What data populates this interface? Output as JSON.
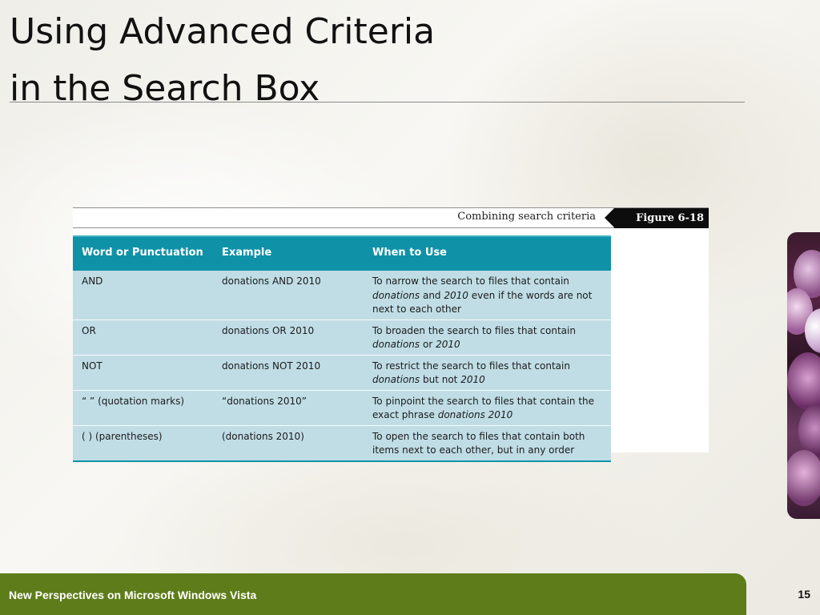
{
  "slide": {
    "title_line1": "Using Advanced Criteria",
    "title_line2": "in the Search Box"
  },
  "figure": {
    "caption": "Combining search criteria",
    "tag": "Figure 6-18",
    "table": {
      "headers": [
        "Word or Punctuation",
        "Example",
        "When to Use"
      ],
      "rows": [
        {
          "word": "AND",
          "example": "donations AND 2010",
          "use_parts": [
            "To narrow the search to files that contain ",
            "donations",
            " and ",
            "2010",
            " even if the words are not next to each other"
          ]
        },
        {
          "word": "OR",
          "example": "donations OR 2010",
          "use_parts": [
            "To broaden the search to files that contain ",
            "donations",
            " or ",
            "2010",
            ""
          ]
        },
        {
          "word": "NOT",
          "example": "donations NOT 2010",
          "use_parts": [
            "To restrict the search to files that contain ",
            "donations",
            " but not ",
            "2010",
            ""
          ]
        },
        {
          "word": "“ ” (quotation marks)",
          "example": "“donations 2010”",
          "use_parts": [
            "To pinpoint the search to files that contain the exact phrase ",
            "donations 2010",
            "",
            "",
            ""
          ]
        },
        {
          "word": "( ) (parentheses)",
          "example": "(donations 2010)",
          "use_parts": [
            "To open the search to files that contain both items next to each other, but in any order",
            "",
            "",
            "",
            ""
          ]
        }
      ]
    }
  },
  "footer": {
    "text": "New Perspectives on Microsoft Windows Vista",
    "page_number": "15"
  },
  "colors": {
    "header_teal": "#0f92a8",
    "row_blue": "#c0dde6",
    "footer_green": "#5e7d1a"
  },
  "decor": {
    "right_image": "purple-flower-photo"
  }
}
